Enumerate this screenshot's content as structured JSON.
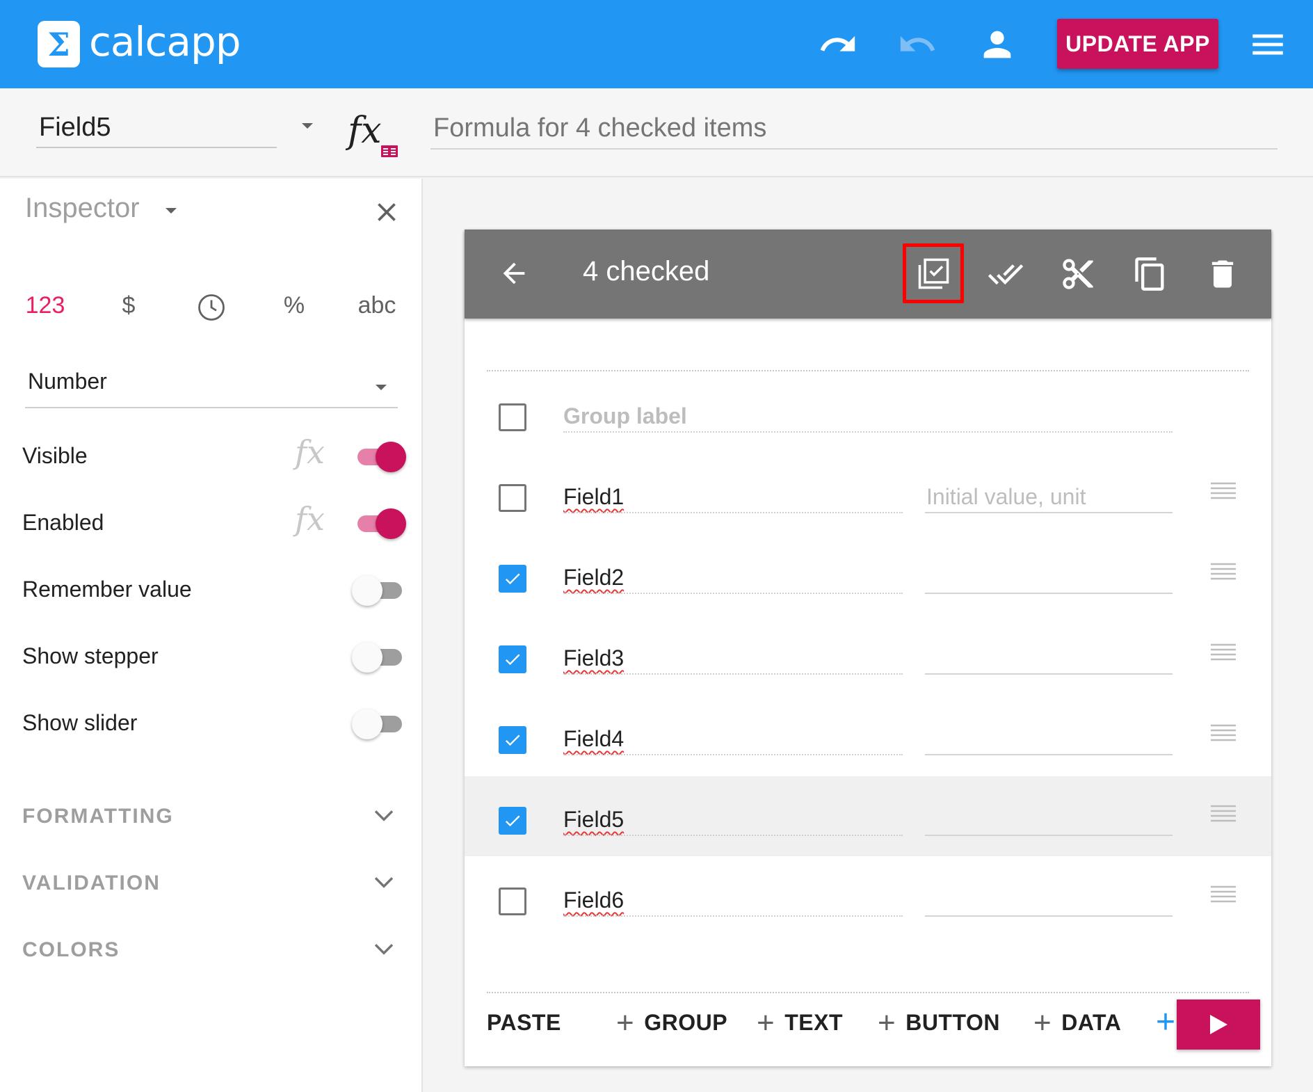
{
  "app": {
    "logo_glyph": "Σ",
    "brand": "calcapp",
    "update_label": "UPDATE APP"
  },
  "colors": {
    "primary": "#2196f3",
    "accent": "#c8125c",
    "toolbar": "#757575"
  },
  "fieldbar": {
    "selected_field": "Field5",
    "formula_placeholder": "Formula for 4 checked items"
  },
  "inspector": {
    "title": "Inspector",
    "types": [
      "123",
      "$",
      "clock-icon",
      "%",
      "abc"
    ],
    "active_type": "123",
    "number_format": "Number",
    "properties": [
      {
        "label": "Visible",
        "has_fx": true,
        "on": true
      },
      {
        "label": "Enabled",
        "has_fx": true,
        "on": true
      },
      {
        "label": "Remember value",
        "has_fx": false,
        "on": false
      },
      {
        "label": "Show stepper",
        "has_fx": false,
        "on": false
      },
      {
        "label": "Show slider",
        "has_fx": false,
        "on": false
      }
    ],
    "sections": [
      "FORMATTING",
      "VALIDATION",
      "COLORS"
    ]
  },
  "selection_toolbar": {
    "count_label": "4 checked"
  },
  "group": {
    "label_placeholder": "Group label"
  },
  "fields": [
    {
      "name": "Field1",
      "checked": false,
      "value_placeholder": "Initial value, unit"
    },
    {
      "name": "Field2",
      "checked": true,
      "value_placeholder": ""
    },
    {
      "name": "Field3",
      "checked": true,
      "value_placeholder": ""
    },
    {
      "name": "Field4",
      "checked": true,
      "value_placeholder": ""
    },
    {
      "name": "Field5",
      "checked": true,
      "value_placeholder": "",
      "selected": true
    },
    {
      "name": "Field6",
      "checked": false,
      "value_placeholder": ""
    }
  ],
  "bottom_actions": {
    "paste": "PASTE",
    "group": "GROUP",
    "text": "TEXT",
    "button": "BUTTON",
    "data": "DATA"
  }
}
